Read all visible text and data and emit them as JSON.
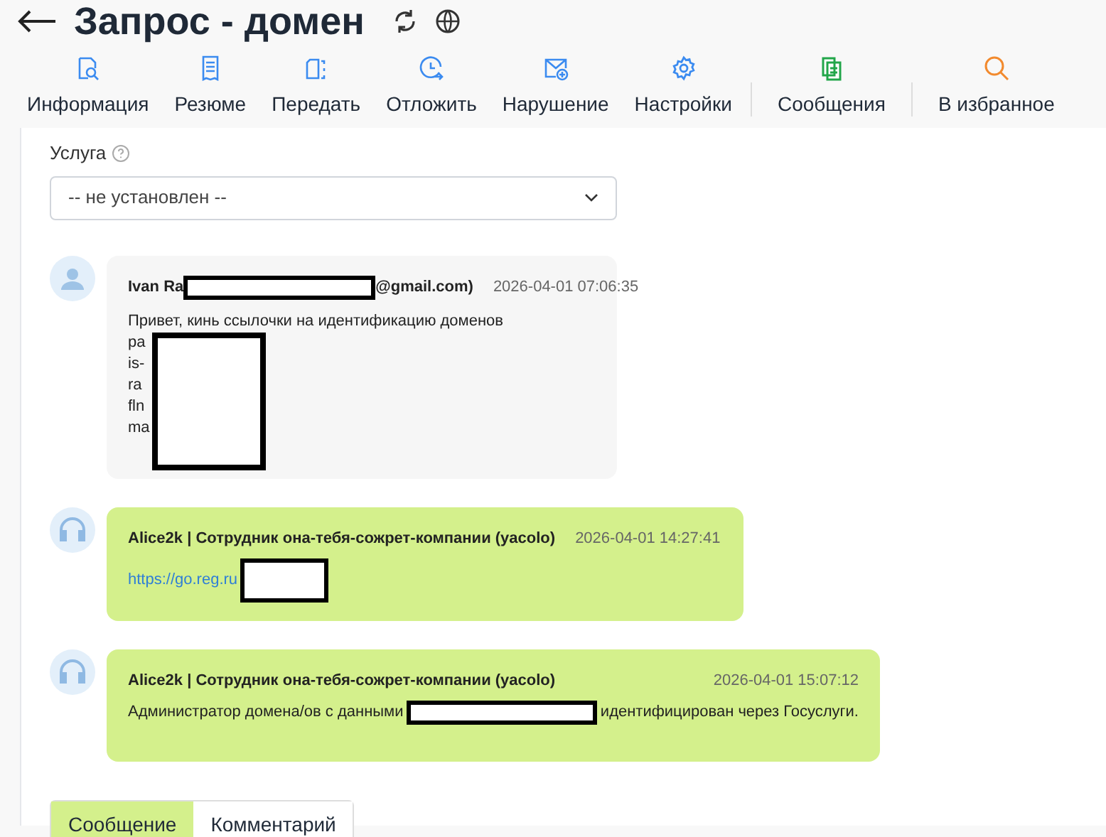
{
  "header": {
    "title": "Запрос - домен"
  },
  "toolbar": [
    {
      "label": "Информация",
      "color": "#3b8bf0",
      "divider_before": false
    },
    {
      "label": "Резюме",
      "color": "#3b8bf0",
      "divider_before": false
    },
    {
      "label": "Передать",
      "color": "#3b8bf0",
      "divider_before": false
    },
    {
      "label": "Отложить",
      "color": "#3b8bf0",
      "divider_before": false
    },
    {
      "label": "Нарушение",
      "color": "#3b8bf0",
      "divider_before": false
    },
    {
      "label": "Настройки",
      "color": "#3b8bf0",
      "divider_before": false
    },
    {
      "label": "Сообщения",
      "color": "#22a64a",
      "divider_before": true
    },
    {
      "label": "В избранное",
      "color": "#f28a2e",
      "divider_before": true
    }
  ],
  "service": {
    "label": "Услуга",
    "value": "-- не установлен --"
  },
  "messages": [
    {
      "kind": "client",
      "author": [
        {
          "kind": "text",
          "text": "Ivan Ra"
        },
        {
          "kind": "redaction"
        },
        {
          "kind": "text",
          "text": "@gmail.com)"
        }
      ],
      "time": "2026-04-01 07:06:35",
      "lines": [
        "Привет, кинь ссылочки на идентификацию доменов",
        "pa",
        "is-",
        "ra",
        "fln",
        "ma"
      ]
    },
    {
      "kind": "agent",
      "author": [
        {
          "kind": "text",
          "text": "Alice2k | Сотрудник она-тебя-сожрет-компании (yacolo)"
        }
      ],
      "time": "2026-04-01 14:27:41",
      "body": [
        {
          "kind": "link",
          "text": "https://go.reg.ru"
        },
        {
          "kind": "short_redaction"
        }
      ]
    },
    {
      "kind": "agent",
      "author": [
        {
          "kind": "text",
          "text": "Alice2k | Сотрудник она-тебя-сожрет-компании (yacolo)"
        }
      ],
      "time": "2026-04-01 15:07:12",
      "body": [
        {
          "kind": "text",
          "text": "Администратор домена/ов с данными"
        },
        {
          "kind": "redaction"
        },
        {
          "kind": "text",
          "text": "идентифицирован через Госуслуги."
        }
      ]
    }
  ],
  "reply_tabs": [
    {
      "label": "Сообщение",
      "selected": true
    },
    {
      "label": "Комментарий",
      "selected": false
    }
  ]
}
